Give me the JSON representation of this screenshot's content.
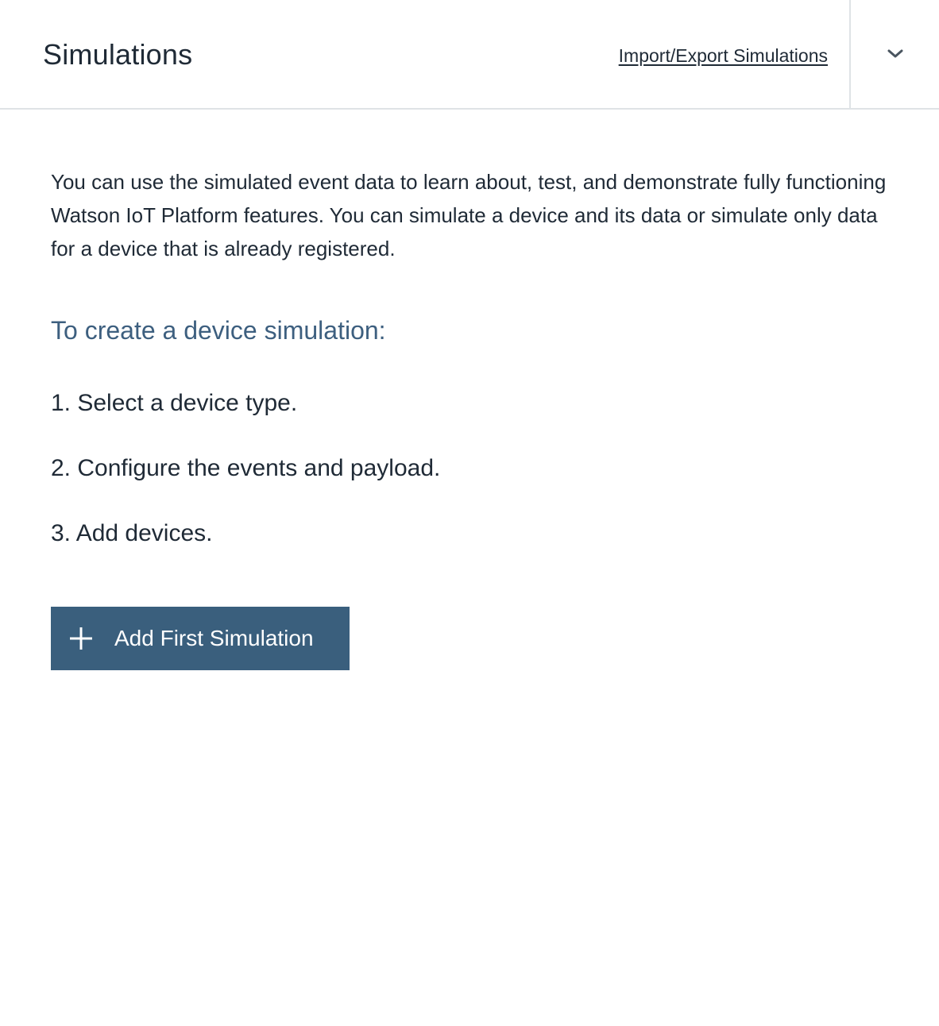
{
  "header": {
    "title": "Simulations",
    "import_export_link": "Import/Export Simulations",
    "expand_icon": "chevron-down-icon"
  },
  "main": {
    "intro": "You can use the simulated event data to learn about, test, and demonstrate fully functioning Watson IoT Platform features. You can simulate a device and its data or simulate only data for a device that is already registered.",
    "subheading": "To create a device simulation:",
    "steps": [
      "1. Select a device type.",
      "2. Configure the events and payload.",
      "3. Add devices."
    ],
    "add_button": {
      "label": "Add First Simulation",
      "icon": "plus-icon"
    }
  },
  "colors": {
    "primary_button": "#3a5f7d",
    "subheading": "#3d5f7f",
    "text": "#1f2a36",
    "divider": "#dfe3e6"
  }
}
